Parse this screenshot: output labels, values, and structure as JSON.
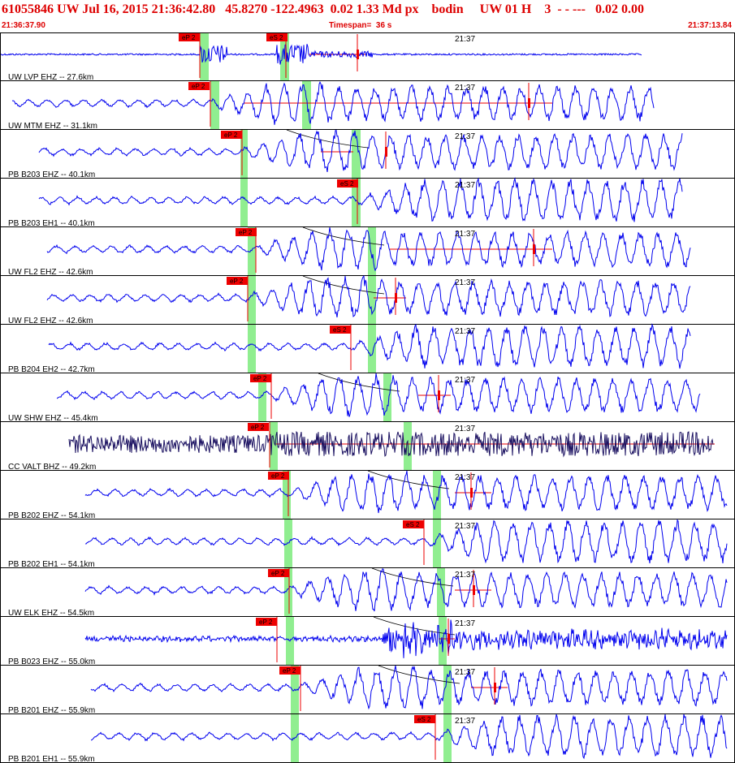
{
  "header": {
    "title": "61055846 UW Jul 16, 2015 21:36:42.80   45.8270 -122.4963  0.02 1.33 Md px    bodin     UW 01 H    3  - - ---   0.02 0.00",
    "start_time": "21:36:37.90",
    "timespan": "Timespan=  36 s",
    "end_time": "21:37:13.84"
  },
  "minute_tick_label": "21:37",
  "colors": {
    "trace": "#0000ee",
    "trace_dark": "#1a1060",
    "pick": "#ee0000",
    "window": "#90ee90",
    "header_text": "#dd0000",
    "divider": "#000000"
  },
  "channels": [
    {
      "label": "UW LVP EHZ -- 27.6km",
      "picks": [
        "eP 2",
        "eS 2"
      ],
      "amp": "medium",
      "color": "blue"
    },
    {
      "label": "UW MTM EHZ -- 31.1km",
      "picks": [
        "eP 2"
      ],
      "amp": "medium",
      "color": "blue"
    },
    {
      "label": "PB B203 EHZ -- 40.1km",
      "picks": [
        "eP 2"
      ],
      "amp": "large",
      "color": "blue"
    },
    {
      "label": "PB B203 EH1 -- 40.1km",
      "picks": [
        "eS 2"
      ],
      "amp": "large",
      "color": "blue"
    },
    {
      "label": "UW FL2 EHZ -- 42.6km",
      "picks": [
        "eP 2"
      ],
      "amp": "large",
      "color": "blue"
    },
    {
      "label": "UW FL2 EHZ -- 42.6km",
      "picks": [
        "eP 2"
      ],
      "amp": "large",
      "color": "blue"
    },
    {
      "label": "PB B204 EH2 -- 42.7km",
      "picks": [
        "eS 2"
      ],
      "amp": "large",
      "color": "blue"
    },
    {
      "label": "UW SHW EHZ -- 45.4km",
      "picks": [
        "eP 2"
      ],
      "amp": "large",
      "color": "blue"
    },
    {
      "label": "CC VALT BHZ -- 49.2km",
      "picks": [
        "eP 2"
      ],
      "amp": "dense",
      "color": "dark"
    },
    {
      "label": "PB B202 EHZ -- 54.1km",
      "picks": [
        "eP 2"
      ],
      "amp": "large",
      "color": "blue"
    },
    {
      "label": "PB B202 EH1 -- 54.1km",
      "picks": [
        "eS 2"
      ],
      "amp": "large",
      "color": "blue"
    },
    {
      "label": "UW ELK EHZ -- 54.5km",
      "picks": [
        "eP 2"
      ],
      "amp": "large",
      "color": "blue"
    },
    {
      "label": "PB B023 EHZ -- 55.0km",
      "picks": [
        "eP 2"
      ],
      "amp": "burst",
      "color": "blue"
    },
    {
      "label": "PB B201 EHZ -- 55.9km",
      "picks": [
        "eP 2"
      ],
      "amp": "large",
      "color": "blue"
    },
    {
      "label": "PB B201 EH1 -- 55.9km",
      "picks": [
        "eS 2"
      ],
      "amp": "large",
      "color": "blue"
    }
  ]
}
